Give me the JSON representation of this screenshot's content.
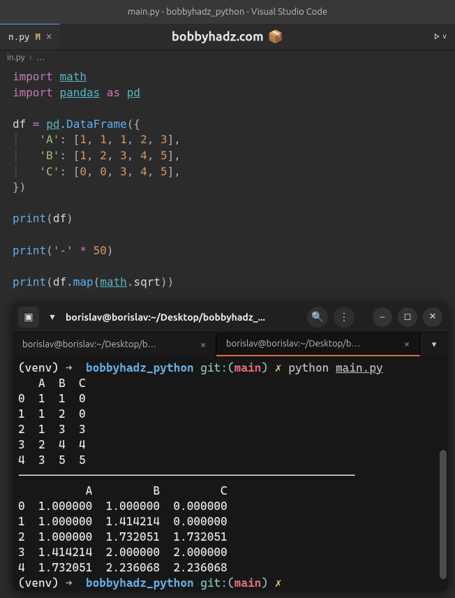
{
  "window": {
    "title": "main.py - bobbyhadz_python - Visual Studio Code"
  },
  "tab": {
    "filename": "n.py",
    "modified": "M",
    "close": "×"
  },
  "brand": {
    "text": "bobbyhadz.com",
    "icon": "📦"
  },
  "run": {
    "play": "▷",
    "chev": "v"
  },
  "breadcrumb": {
    "file": "in.py",
    "rest": "…"
  },
  "code": {
    "l1_import": "import",
    "l1_math": "math",
    "l2_import": "import",
    "l2_pandas": "pandas",
    "l2_as": "as",
    "l2_pd": "pd",
    "l4_df": "df",
    "l4_eq": "=",
    "l4_pd": "pd",
    "l4_dot": ".",
    "l4_fn": "DataFrame",
    "l4_open": "({",
    "l5_key": "'A'",
    "l5_colon": ": [",
    "l5_v": "1, 1, 1, 2, 3",
    "l5_close": "],",
    "l6_key": "'B'",
    "l6_colon": ": [",
    "l6_v": "1, 2, 3, 4, 5",
    "l6_close": "],",
    "l7_key": "'C'",
    "l7_colon": ": [",
    "l7_v": "0, 0, 3, 4, 5",
    "l7_close": "],",
    "l8_close": "})",
    "l10_print": "print",
    "l10_open": "(",
    "l10_arg": "df",
    "l10_close": ")",
    "l12_print": "print",
    "l12_open": "(",
    "l12_s": "'-'",
    "l12_star": " * ",
    "l12_n": "50",
    "l12_close": ")",
    "l14_print": "print",
    "l14_open": "(",
    "l14_df": "df",
    "l14_dot1": ".",
    "l14_map": "map",
    "l14_p1": "(",
    "l14_math": "math",
    "l14_dot2": ".",
    "l14_sqrt": "sqrt",
    "l14_p2": "))"
  },
  "terminal": {
    "toolbar": {
      "newtab_icon": "▣",
      "newtab_chev": "▾",
      "title": "borislav@borislav:~/Desktop/bobbyhadz_...",
      "search_icon": "🔍",
      "menu_icon": "⋮",
      "minimize": "–",
      "maximize": "◻",
      "close": "✕"
    },
    "tabs": {
      "t1": "borislav@borislav:~/Desktop/b…",
      "t2": "borislav@borislav:~/Desktop/b…",
      "add": "▾"
    },
    "prompt": {
      "venv": "(venv)",
      "arrow": "➜",
      "cwd": "bobbyhadz_python",
      "git": "git:(",
      "branch": "main",
      "gitclose": ")",
      "x": "✗",
      "python": "python",
      "script": "main.py"
    },
    "output": {
      "hdr": "   A  B  C",
      "r0": "0  1  1  0",
      "r1": "1  1  2  0",
      "r2": "2  1  3  3",
      "r3": "3  2  4  4",
      "r4": "4  3  5  5",
      "sep": "--------------------------------------------------",
      "h2": "          A         B         C",
      "s0": "0  1.000000  1.000000  0.000000",
      "s1": "1  1.000000  1.414214  0.000000",
      "s2": "2  1.000000  1.732051  1.732051",
      "s3": "3  1.414214  2.000000  2.000000",
      "s4": "4  1.732051  2.236068  2.236068"
    }
  }
}
